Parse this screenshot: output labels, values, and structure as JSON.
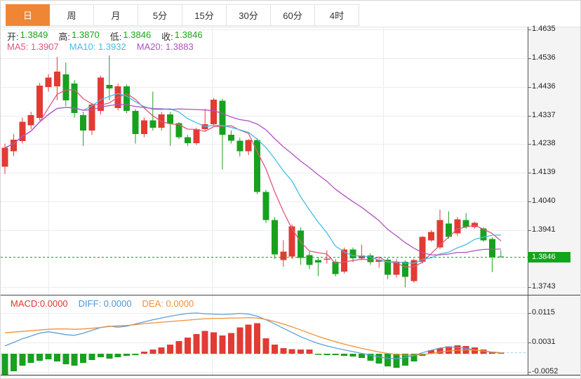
{
  "tabs": [
    {
      "label": "日",
      "active": true
    },
    {
      "label": "周",
      "active": false
    },
    {
      "label": "月",
      "active": false
    },
    {
      "label": "5分",
      "active": false
    },
    {
      "label": "15分",
      "active": false
    },
    {
      "label": "30分",
      "active": false
    },
    {
      "label": "60分",
      "active": false
    },
    {
      "label": "4时",
      "active": false
    }
  ],
  "ohlc": {
    "open_label": "开:",
    "open": "1.3849",
    "high_label": "高:",
    "high": "1.3870",
    "low_label": "低:",
    "low": "1.3846",
    "close_label": "收:",
    "close": "1.3846"
  },
  "ma_legend": {
    "ma5_label": "MA5:",
    "ma5": "1.3907",
    "ma10_label": "MA10:",
    "ma10": "1.3932",
    "ma20_label": "MA20:",
    "ma20": "1.3883"
  },
  "macd_legend": {
    "macd_label": "MACD:",
    "macd": "0.0000",
    "diff_label": "DIFF:",
    "diff": "0.0000",
    "dea_label": "DEA:",
    "dea": "0.0000"
  },
  "axis": {
    "price_labels": [
      "1.4635",
      "1.4536",
      "1.4436",
      "1.4337",
      "1.4238",
      "1.4139",
      "1.4040",
      "1.3941",
      "1.3743"
    ],
    "current_price": "1.3846",
    "macd_labels": [
      "0.0115",
      "0.0031",
      "-0.0052"
    ]
  },
  "colors": {
    "up": "#e13b34",
    "down": "#18a11e",
    "current_price_line": "#14a417",
    "badge_bg": "#12a41a",
    "ma5": "#e0557d",
    "ma10": "#45bce8",
    "ma20": "#b052c0",
    "diff_line": "#5d9fd8",
    "dea_line": "#ef9136",
    "tab_active_bg": "#ef8636",
    "axis_panel_bg": "#f4f4f4",
    "grid": "#ececec",
    "vgrid": "#e7edf3"
  },
  "chart_data": {
    "type": "candlestick",
    "convention": "red = up, green = down (CN style)",
    "price_axis_ticks": [
      1.4635,
      1.4536,
      1.4436,
      1.4337,
      1.4238,
      1.4139,
      1.404,
      1.3941,
      1.3743
    ],
    "current_price": 1.3846,
    "ma_periods": [
      5,
      10,
      20
    ],
    "candles": [
      [
        1.416,
        1.424,
        1.4135,
        1.4225
      ],
      [
        1.4213,
        1.4273,
        1.4196,
        1.4254
      ],
      [
        1.4249,
        1.433,
        1.424,
        1.4315
      ],
      [
        1.4303,
        1.435,
        1.429,
        1.4339
      ],
      [
        1.4329,
        1.445,
        1.432,
        1.4441
      ],
      [
        1.4436,
        1.448,
        1.442,
        1.4468
      ],
      [
        1.4438,
        1.454,
        1.439,
        1.4489
      ],
      [
        1.448,
        1.4521,
        1.437,
        1.439
      ],
      [
        1.4448,
        1.446,
        1.433,
        1.4346
      ],
      [
        1.4339,
        1.435,
        1.4232,
        1.4285
      ],
      [
        1.4285,
        1.438,
        1.427,
        1.4375
      ],
      [
        1.4353,
        1.4475,
        1.434,
        1.4468
      ],
      [
        1.4443,
        1.4545,
        1.439,
        1.4431
      ],
      [
        1.4363,
        1.4448,
        1.4355,
        1.4438
      ],
      [
        1.4438,
        1.4445,
        1.4345,
        1.4353
      ],
      [
        1.4353,
        1.436,
        1.424,
        1.4273
      ],
      [
        1.4273,
        1.433,
        1.4262,
        1.432
      ],
      [
        1.432,
        1.442,
        1.4285,
        1.4295
      ],
      [
        1.4295,
        1.435,
        1.4285,
        1.4341
      ],
      [
        1.4341,
        1.435,
        1.4232,
        1.431
      ],
      [
        1.431,
        1.4315,
        1.4255,
        1.4262
      ],
      [
        1.4262,
        1.427,
        1.4232,
        1.4241
      ],
      [
        1.4241,
        1.4295,
        1.4235,
        1.429
      ],
      [
        1.429,
        1.436,
        1.4285,
        1.4307
      ],
      [
        1.4307,
        1.4398,
        1.43,
        1.4392
      ],
      [
        1.4388,
        1.4395,
        1.415,
        1.427
      ],
      [
        1.427,
        1.4285,
        1.424,
        1.425
      ],
      [
        1.425,
        1.426,
        1.4195,
        1.4213
      ],
      [
        1.4213,
        1.4256,
        1.42,
        1.4252
      ],
      [
        1.4252,
        1.4258,
        1.4065,
        1.4072
      ],
      [
        1.4072,
        1.408,
        1.3965,
        1.3975
      ],
      [
        1.3975,
        1.3985,
        1.384,
        1.3856
      ],
      [
        1.3837,
        1.3905,
        1.3813,
        1.3866
      ],
      [
        1.3849,
        1.396,
        1.384,
        1.3953
      ],
      [
        1.3939,
        1.395,
        1.382,
        1.3844
      ],
      [
        1.3854,
        1.3865,
        1.3805,
        1.382
      ],
      [
        1.3836,
        1.3845,
        1.3781,
        1.3828
      ],
      [
        1.3838,
        1.387,
        1.3825,
        1.3842
      ],
      [
        1.383,
        1.384,
        1.378,
        1.3788
      ],
      [
        1.3796,
        1.388,
        1.379,
        1.3873
      ],
      [
        1.3873,
        1.388,
        1.383,
        1.3843
      ],
      [
        1.3843,
        1.389,
        1.3835,
        1.3852
      ],
      [
        1.3852,
        1.386,
        1.382,
        1.383
      ],
      [
        1.383,
        1.3845,
        1.381,
        1.3838
      ],
      [
        1.3838,
        1.3845,
        1.377,
        1.3785
      ],
      [
        1.3785,
        1.384,
        1.3775,
        1.383
      ],
      [
        1.383,
        1.3836,
        1.3742,
        1.3778
      ],
      [
        1.3764,
        1.3842,
        1.3758,
        1.3837
      ],
      [
        1.383,
        1.392,
        1.3825,
        1.3917
      ],
      [
        1.3905,
        1.394,
        1.39,
        1.3934
      ],
      [
        1.388,
        1.4011,
        1.3875,
        1.3975
      ],
      [
        1.3963,
        1.4005,
        1.391,
        1.3917
      ],
      [
        1.3929,
        1.3985,
        1.392,
        1.3978
      ],
      [
        1.3975,
        1.3999,
        1.3945,
        1.3951
      ],
      [
        1.3951,
        1.397,
        1.3945,
        1.3965
      ],
      [
        1.3946,
        1.395,
        1.39,
        1.3905
      ],
      [
        1.391,
        1.3915,
        1.3795,
        1.3846
      ],
      [
        1.3849,
        1.387,
        1.3846,
        1.3846
      ]
    ],
    "macd": {
      "axis_ticks": [
        0.0115,
        0.0031,
        -0.0052
      ],
      "hist": [
        -0.006,
        -0.005,
        -0.0034,
        -0.0026,
        -0.002,
        -0.0016,
        -0.0022,
        -0.003,
        -0.0034,
        -0.0026,
        -0.0018,
        -0.001,
        -0.0014,
        -0.001,
        -0.0006,
        -0.0004,
        0.0006,
        0.0012,
        0.0018,
        0.0026,
        0.0036,
        0.0046,
        0.0056,
        0.0064,
        0.006,
        0.0052,
        0.0058,
        0.0074,
        0.0082,
        0.0086,
        0.0044,
        0.0026,
        0.0016,
        0.0013,
        0.0012,
        0.0012,
        -0.0003,
        -0.0004,
        -0.0004,
        -0.0006,
        -0.0008,
        -0.0012,
        -0.002,
        -0.0028,
        -0.0036,
        -0.004,
        -0.0034,
        -0.0022,
        -0.0006,
        0.001,
        0.0016,
        0.0021,
        0.0024,
        0.0022,
        0.0018,
        0.0012,
        0.0006,
        0.0003
      ],
      "diff": [
        0.0022,
        0.0032,
        0.0042,
        0.005,
        0.0058,
        0.0062,
        0.0058,
        0.0054,
        0.0052,
        0.0058,
        0.0066,
        0.0074,
        0.0078,
        0.0075,
        0.0078,
        0.0084,
        0.009,
        0.0096,
        0.0101,
        0.0106,
        0.011,
        0.0114,
        0.0115,
        0.0113,
        0.0112,
        0.0111,
        0.0112,
        0.0114,
        0.0112,
        0.0106,
        0.0096,
        0.0084,
        0.0072,
        0.006,
        0.0048,
        0.0038,
        0.0029,
        0.0022,
        0.0016,
        0.0011,
        0.0006,
        0.0001,
        -0.0004,
        -0.0009,
        -0.0013,
        -0.0014,
        -0.0011,
        -0.0005,
        0.0003,
        0.001,
        0.0016,
        0.0019,
        0.0018,
        0.0015,
        0.0011,
        0.0007,
        0.0004,
        0.0002
      ],
      "dea": [
        0.0059,
        0.0061,
        0.0063,
        0.0065,
        0.0067,
        0.0069,
        0.007,
        0.007,
        0.0069,
        0.007,
        0.0072,
        0.0074,
        0.0077,
        0.0079,
        0.008,
        0.0082,
        0.0085,
        0.0087,
        0.0089,
        0.0091,
        0.0093,
        0.0095,
        0.0097,
        0.0099,
        0.01,
        0.01,
        0.0101,
        0.0101,
        0.0102,
        0.0101,
        0.0097,
        0.0091,
        0.0084,
        0.0076,
        0.0067,
        0.0058,
        0.0049,
        0.0041,
        0.0034,
        0.0027,
        0.0021,
        0.0015,
        0.001,
        0.0005,
        0.0001,
        -0.0002,
        -0.0004,
        -0.0004,
        -0.0002,
        0.0001,
        0.0005,
        0.0008,
        0.001,
        0.0011,
        0.001,
        0.0008,
        0.0005,
        0.0003
      ]
    }
  }
}
